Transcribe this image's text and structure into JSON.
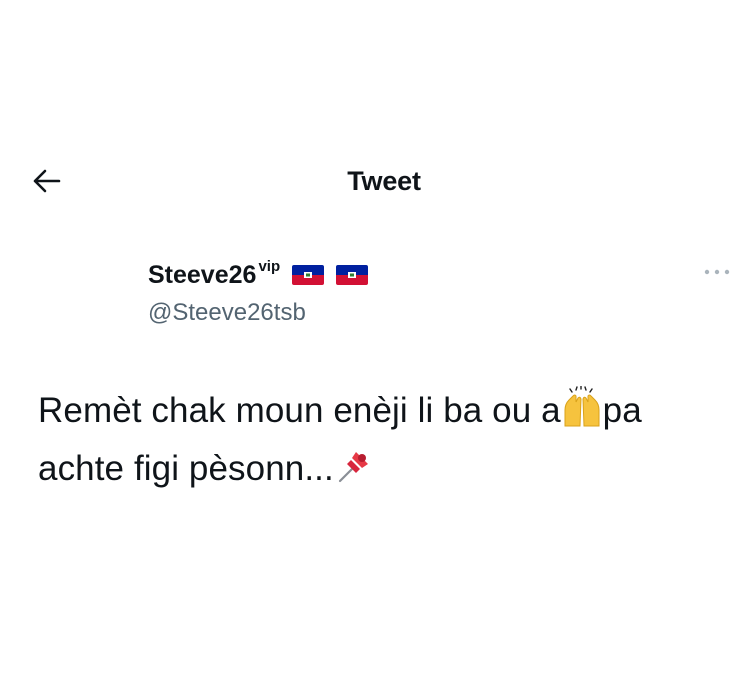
{
  "header": {
    "title": "Tweet",
    "back_icon": "arrow-left-icon"
  },
  "author": {
    "display_name": "Steeve26",
    "superscript": "vip",
    "handle": "@Steeve26tsb",
    "flags": [
      "haiti-flag-icon",
      "haiti-flag-icon"
    ]
  },
  "more_icon": "more-dots-icon",
  "tweet": {
    "line1_before_emoji": "Remèt chak moun enèji li ba ou a",
    "emoji1": "raising-hands-icon",
    "line1_after_emoji": "pa",
    "line2": "achte figi pèsonn...",
    "emoji2": "pushpin-icon"
  },
  "colors": {
    "text": "#0f1419",
    "secondary": "#536471",
    "flag_blue": "#00209f",
    "flag_red": "#d21034",
    "emoji_yellow": "#f6c33e",
    "pin_red": "#d7263d"
  }
}
